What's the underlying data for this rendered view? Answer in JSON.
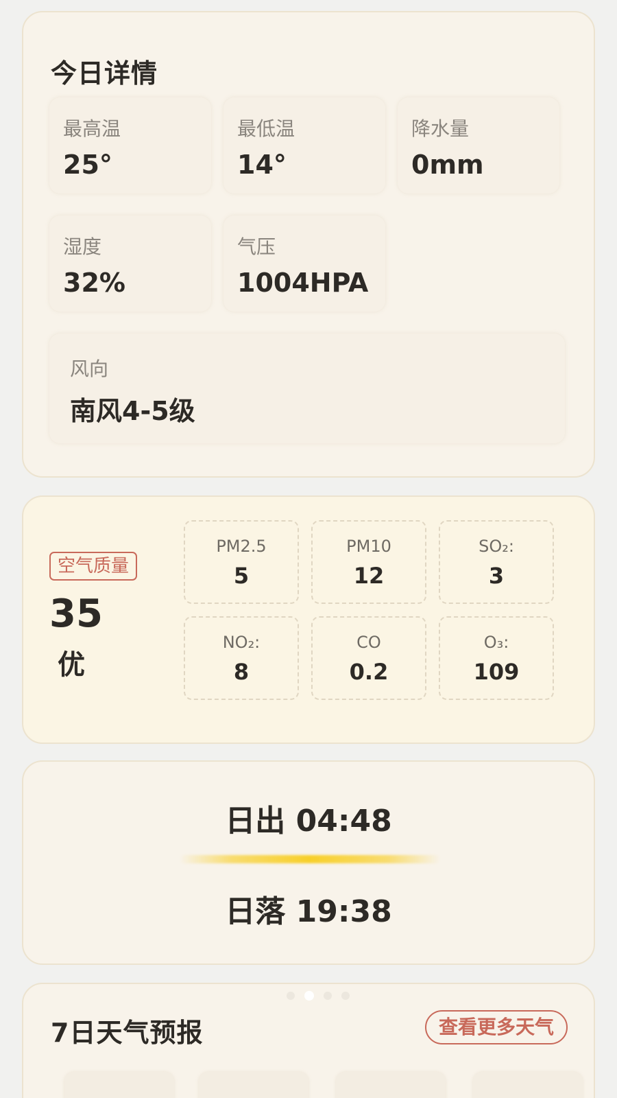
{
  "details": {
    "title": "今日详情",
    "high": {
      "label": "最高温",
      "value": "25°"
    },
    "low": {
      "label": "最低温",
      "value": "14°"
    },
    "precip": {
      "label": "降水量",
      "value": "0mm"
    },
    "humidity": {
      "label": "湿度",
      "value": "32%"
    },
    "pressure": {
      "label": "气压",
      "value": "1004HPA"
    },
    "wind": {
      "label": "风向",
      "value": "南风4-5级"
    }
  },
  "air": {
    "badge": "空气质量",
    "aqi": "35",
    "level": "优",
    "pollutants": [
      {
        "name": "PM2.5",
        "value": "5"
      },
      {
        "name": "PM10",
        "value": "12"
      },
      {
        "name": "SO₂:",
        "value": "3"
      },
      {
        "name": "NO₂:",
        "value": "8"
      },
      {
        "name": "CO",
        "value": "0.2"
      },
      {
        "name": "O₃:",
        "value": "109"
      }
    ]
  },
  "sun": {
    "sunrise": "日出 04:48",
    "sunset": "日落 19:38"
  },
  "forecast": {
    "title": "7日天气预报",
    "more_label": "查看更多天气",
    "pager_active_index": 1,
    "pager_count": 4
  },
  "colors": {
    "accent": "#c8695a",
    "sun_bar": "#f7cf2a",
    "card_bg": "#f8f3ea",
    "aqi_card_bg": "#fbf5e4"
  }
}
